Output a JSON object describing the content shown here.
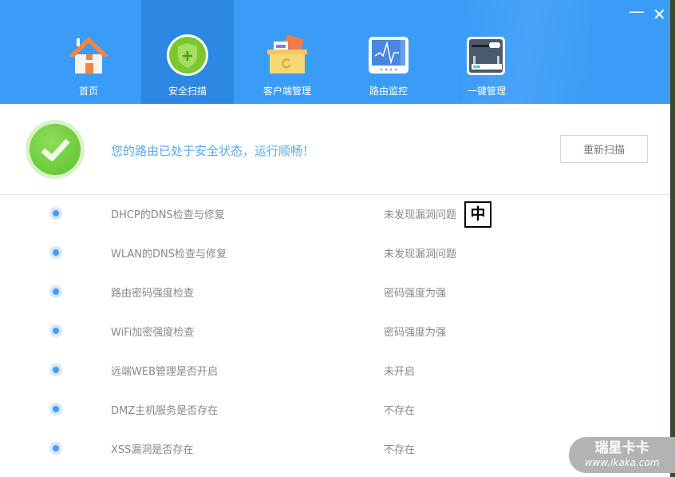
{
  "window": {
    "minimize_icon": "minus-icon",
    "close_icon": "close-icon"
  },
  "tabs": [
    {
      "label": "首页",
      "icon": "home-icon"
    },
    {
      "label": "安全扫描",
      "icon": "shield-icon",
      "active": true
    },
    {
      "label": "客户端管理",
      "icon": "box-icon"
    },
    {
      "label": "路由监控",
      "icon": "monitor-icon"
    },
    {
      "label": "一键管理",
      "icon": "router-icon"
    }
  ],
  "status": {
    "message": "您的路由已处于安全状态，运行顺畅！",
    "rescan_label": "重新扫描"
  },
  "checks": [
    {
      "name": "DHCP的DNS检查与修复",
      "result": "未发现漏洞问题"
    },
    {
      "name": "WLAN的DNS检查与修复",
      "result": "未发现漏洞问题"
    },
    {
      "name": "路由密码强度检查",
      "result": "密码强度为强"
    },
    {
      "name": "WiFi加密强度检查",
      "result": "密码强度为强"
    },
    {
      "name": "远端WEB管理是否开启",
      "result": "未开启"
    },
    {
      "name": "DMZ主机服务是否存在",
      "result": "不存在"
    },
    {
      "name": "XSS漏洞是否存在",
      "result": "不存在"
    }
  ],
  "ime": "中",
  "watermark": {
    "title": "瑞星卡卡",
    "url": "www.ikaka.com"
  },
  "colors": {
    "header": "#3a9cf7",
    "active_tab": "#2d88e3",
    "message": "#5aaaf0"
  }
}
